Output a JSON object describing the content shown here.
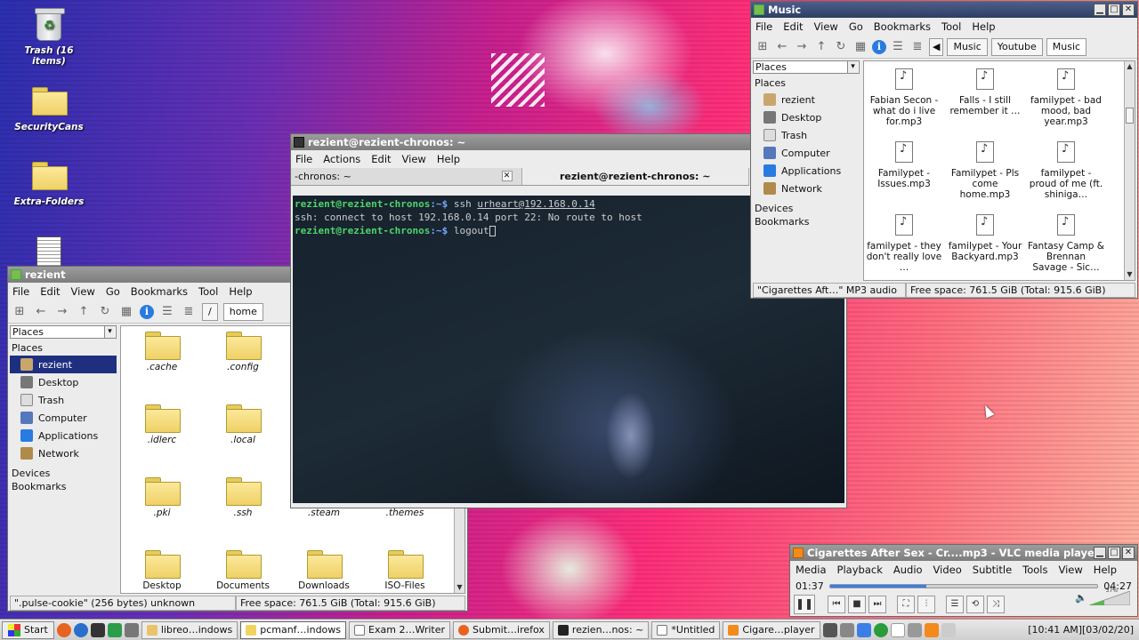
{
  "desktop": {
    "icons": [
      {
        "label": "Trash (16 items)",
        "icon": "trash-icon"
      },
      {
        "label": "SecurityCans",
        "icon": "folder-icon"
      },
      {
        "label": "Extra-Folders",
        "icon": "folder-icon"
      },
      {
        "label": "",
        "icon": "document-icon"
      }
    ]
  },
  "filemanager": {
    "title": "rezient",
    "menu": [
      "File",
      "Edit",
      "View",
      "Go",
      "Bookmarks",
      "Tool",
      "Help"
    ],
    "path": [
      "/",
      "home"
    ],
    "places_select": "Places",
    "places_heading": "Places",
    "places": [
      "rezient",
      "Desktop",
      "Trash",
      "Computer",
      "Applications",
      "Network"
    ],
    "devices": "Devices",
    "bookmarks": "Bookmarks",
    "files": [
      ".cache",
      ".config",
      ".idlerc",
      ".local",
      ".pki",
      ".ssh",
      ".steam",
      ".themes",
      "Desktop",
      "Documents",
      "Downloads",
      "ISO-Files"
    ],
    "status_left": "\".pulse-cookie\" (256 bytes) unknown",
    "status_right": "Free space: 761.5 GiB (Total: 915.6 GiB)"
  },
  "terminal": {
    "title": "rezient@rezient-chronos: ~",
    "menu": [
      "File",
      "Actions",
      "Edit",
      "View",
      "Help"
    ],
    "tabs": [
      "-chronos: ~",
      "rezient@rezient-chronos: ~"
    ],
    "prompt_user": "rezient@rezient-chronos",
    "prompt_path": ":~$ ",
    "line1_cmd": "ssh ",
    "line1_arg": "urheart@192.168.0.14",
    "line2": "ssh: connect to host 192.168.0.14 port 22: No route to host",
    "line3_cmd": "logout"
  },
  "music": {
    "title": "Music",
    "menu": [
      "File",
      "Edit",
      "View",
      "Go",
      "Bookmarks",
      "Tool",
      "Help"
    ],
    "path": [
      "Music",
      "Youtube",
      "Music"
    ],
    "places_select": "Places",
    "places_heading": "Places",
    "places": [
      "rezient",
      "Desktop",
      "Trash",
      "Computer",
      "Applications",
      "Network"
    ],
    "devices": "Devices",
    "bookmarks": "Bookmarks",
    "files": [
      "Fabian Secon - what do i live for.mp3",
      "Falls - I still remember it …",
      "familypet - bad mood, bad year.mp3",
      "Familypet - Issues.mp3",
      "Familypet - Pls come home.mp3",
      "familypet - proud of me (ft. shiniga…",
      "familypet - they don't really love …",
      "familypet - Your Backyard.mp3",
      "Fantasy Camp & Brennan Savage - Sic…"
    ],
    "status_left": "\"Cigarettes Aft…\" MP3 audio",
    "status_right": "Free space: 761.5 GiB (Total: 915.6 GiB)"
  },
  "vlc": {
    "title": "Cigarettes After Sex - Cr....mp3 - VLC media player",
    "menu": [
      "Media",
      "Playback",
      "Audio",
      "Video",
      "Subtitle",
      "Tools",
      "View",
      "Help"
    ],
    "elapsed": "01:37",
    "total": "04:27",
    "progress": 0.36,
    "volume_label": "37%",
    "volume": 0.37
  },
  "taskbar": {
    "start": "Start",
    "tasks": [
      "libreo…indows",
      "pcmanf…indows",
      "Exam 2…Writer",
      "Submit…irefox",
      "rezien…nos: ~",
      "*Untitled",
      "Cigare…player"
    ],
    "clock": "[10:41 AM][03/02/20]"
  },
  "colors": {
    "selection": "#1f2f80",
    "prompt_green": "#4fd46a",
    "prompt_blue": "#7aa7ff",
    "seek_fill": "#3b7ee8"
  }
}
